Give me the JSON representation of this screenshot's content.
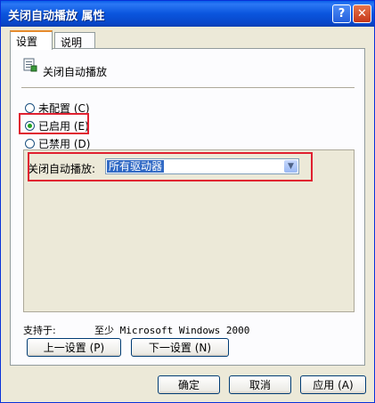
{
  "window": {
    "title": "关闭自动播放 属性",
    "help_label": "?",
    "close_label": "✕"
  },
  "tabs": [
    {
      "label": "设置",
      "active": true
    },
    {
      "label": "说明",
      "active": false
    }
  ],
  "policy": {
    "name": "关闭自动播放",
    "icon": "policy-setting-icon"
  },
  "options": [
    {
      "label": "未配置 (C)",
      "checked": false
    },
    {
      "label": "已启用 (E)",
      "checked": true
    },
    {
      "label": "已禁用 (D)",
      "checked": false
    }
  ],
  "autoplay": {
    "label": "关闭自动播放:",
    "value": "所有驱动器"
  },
  "support": {
    "label": "支持于:",
    "value": "至少 Microsoft Windows 2000"
  },
  "nav": {
    "prev_label": "上一设置 (P)",
    "next_label": "下一设置 (N)"
  },
  "footer": {
    "ok_label": "确定",
    "cancel_label": "取消",
    "apply_label": "应用 (A)"
  },
  "colors": {
    "highlight_box": "#e02030",
    "titlebar": "#0a55dd",
    "selected_value": "#316ac5"
  }
}
